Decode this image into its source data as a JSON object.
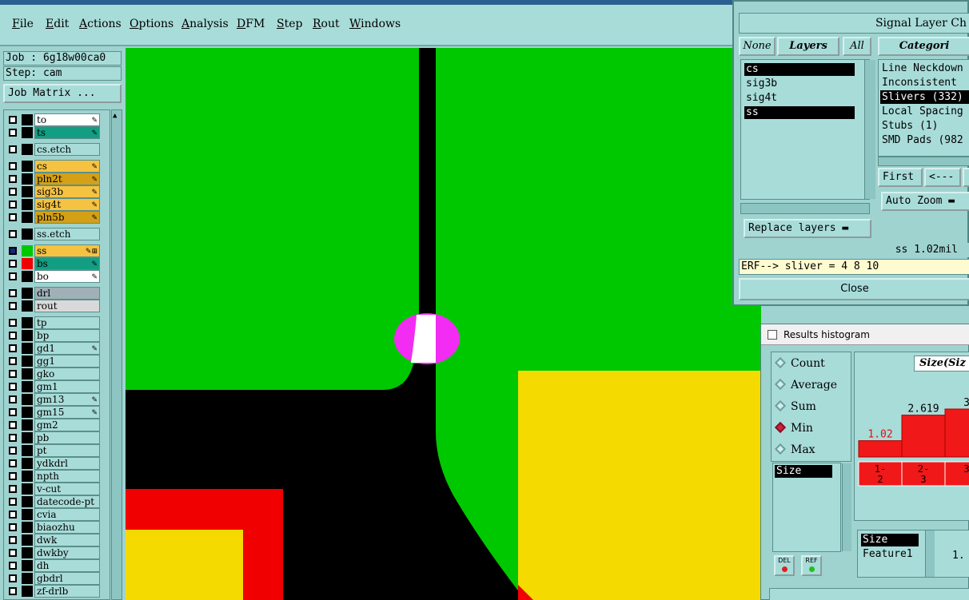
{
  "menubar": {
    "items": [
      "File",
      "Edit",
      "Actions",
      "Options",
      "Analysis",
      "DFM",
      "Step",
      "Rout",
      "Windows"
    ]
  },
  "job": {
    "label": "Job : 6g18w00ca0",
    "step": "Step: cam",
    "matrix_button": "Job Matrix ..."
  },
  "layers": [
    {
      "name": "to",
      "color": "#ffffff",
      "flag": "✎"
    },
    {
      "name": "ts",
      "color": "#129e82",
      "flag": "✎"
    },
    {
      "name": "cs.etch",
      "color": "#a8dcd9",
      "flag": ""
    },
    {
      "name": "cs",
      "color": "#f5c242",
      "flag": "✎"
    },
    {
      "name": "pln2t",
      "color": "#d4a017",
      "flag": "✎"
    },
    {
      "name": "sig3b",
      "color": "#f5c242",
      "flag": "✎"
    },
    {
      "name": "sig4t",
      "color": "#f5c242",
      "flag": "✎"
    },
    {
      "name": "pln5b",
      "color": "#d4a017",
      "flag": "✎"
    },
    {
      "name": "ss.etch",
      "color": "#a8dcd9",
      "flag": ""
    },
    {
      "name": "ss",
      "color": "#f5c242",
      "flag": "✎⊞"
    },
    {
      "name": "bs",
      "color": "#129e82",
      "flag": "✎"
    },
    {
      "name": "bo",
      "color": "#ffffff",
      "flag": "✎"
    },
    {
      "name": "drl",
      "color": "#9fb0b6",
      "flag": ""
    },
    {
      "name": "rout",
      "color": "#d9d9d9",
      "flag": ""
    },
    {
      "name": "tp",
      "color": "#a8dcd9",
      "flag": ""
    },
    {
      "name": "bp",
      "color": "#a8dcd9",
      "flag": ""
    },
    {
      "name": "gd1",
      "color": "#a8dcd9",
      "flag": "✎"
    },
    {
      "name": "gg1",
      "color": "#a8dcd9",
      "flag": ""
    },
    {
      "name": "gko",
      "color": "#a8dcd9",
      "flag": ""
    },
    {
      "name": "gm1",
      "color": "#a8dcd9",
      "flag": ""
    },
    {
      "name": "gm13",
      "color": "#a8dcd9",
      "flag": "✎"
    },
    {
      "name": "gm15",
      "color": "#a8dcd9",
      "flag": "✎"
    },
    {
      "name": "gm2",
      "color": "#a8dcd9",
      "flag": ""
    },
    {
      "name": "pb",
      "color": "#a8dcd9",
      "flag": ""
    },
    {
      "name": "pt",
      "color": "#a8dcd9",
      "flag": ""
    },
    {
      "name": "ydkdrl",
      "color": "#a8dcd9",
      "flag": ""
    },
    {
      "name": "npth",
      "color": "#a8dcd9",
      "flag": ""
    },
    {
      "name": "v-cut",
      "color": "#a8dcd9",
      "flag": ""
    },
    {
      "name": "datecode-pt",
      "color": "#a8dcd9",
      "flag": ""
    },
    {
      "name": "cvia",
      "color": "#a8dcd9",
      "flag": ""
    },
    {
      "name": "biaozhu",
      "color": "#a8dcd9",
      "flag": ""
    },
    {
      "name": "dwk",
      "color": "#a8dcd9",
      "flag": ""
    },
    {
      "name": "dwkby",
      "color": "#a8dcd9",
      "flag": ""
    },
    {
      "name": "dh",
      "color": "#a8dcd9",
      "flag": ""
    },
    {
      "name": "gbdrl",
      "color": "#a8dcd9",
      "flag": ""
    },
    {
      "name": "zf-drlb",
      "color": "#a8dcd9",
      "flag": ""
    }
  ],
  "slc": {
    "title": "Signal Layer Ch",
    "none": "None",
    "layers_tab": "Layers",
    "all": "All",
    "categories_tab": "Categori",
    "layer_list": [
      {
        "name": "cs",
        "selected": true
      },
      {
        "name": "sig3b",
        "selected": false
      },
      {
        "name": "sig4t",
        "selected": false
      },
      {
        "name": "ss",
        "selected": true
      }
    ],
    "categories": [
      {
        "name": "Line Neckdown",
        "selected": false
      },
      {
        "name": "Inconsistent",
        "selected": false
      },
      {
        "name": "Slivers (332)",
        "selected": true
      },
      {
        "name": "Local Spacing",
        "selected": false
      },
      {
        "name": "Stubs (1)",
        "selected": false
      },
      {
        "name": "SMD Pads (982",
        "selected": false
      }
    ],
    "first": "First",
    "prev": "<---",
    "auto_zoom": "Auto Zoom",
    "replace_layers": "Replace layers",
    "status": "ss 1.02mil",
    "erf": "ERF--> sliver = 4 8 10",
    "close": "Close"
  },
  "hist": {
    "title": "Results histogram",
    "modes": [
      {
        "label": "Count",
        "on": false
      },
      {
        "label": "Average",
        "on": false
      },
      {
        "label": "Sum",
        "on": false
      },
      {
        "label": "Min",
        "on": true
      },
      {
        "label": "Max",
        "on": false
      }
    ],
    "size_item": "Size",
    "del": "DEL",
    "ref": "REF",
    "header": "Size(Siz",
    "bars": [
      {
        "label": "1.02",
        "range": "1-\n2",
        "value": 1.02
      },
      {
        "label": "2.619",
        "range": "2-\n3",
        "value": 2.619
      },
      {
        "label": "3",
        "range": "3",
        "value": 3.0
      }
    ],
    "list2": [
      "Size",
      "Feature1"
    ],
    "right_value": "1."
  },
  "colors": {
    "bg": "#9fd3d0",
    "panel": "#a8dcd9",
    "canvas_green": "#00c800",
    "yellow": "#f5da00",
    "red": "#f00000",
    "magenta": "#f22cf2"
  }
}
